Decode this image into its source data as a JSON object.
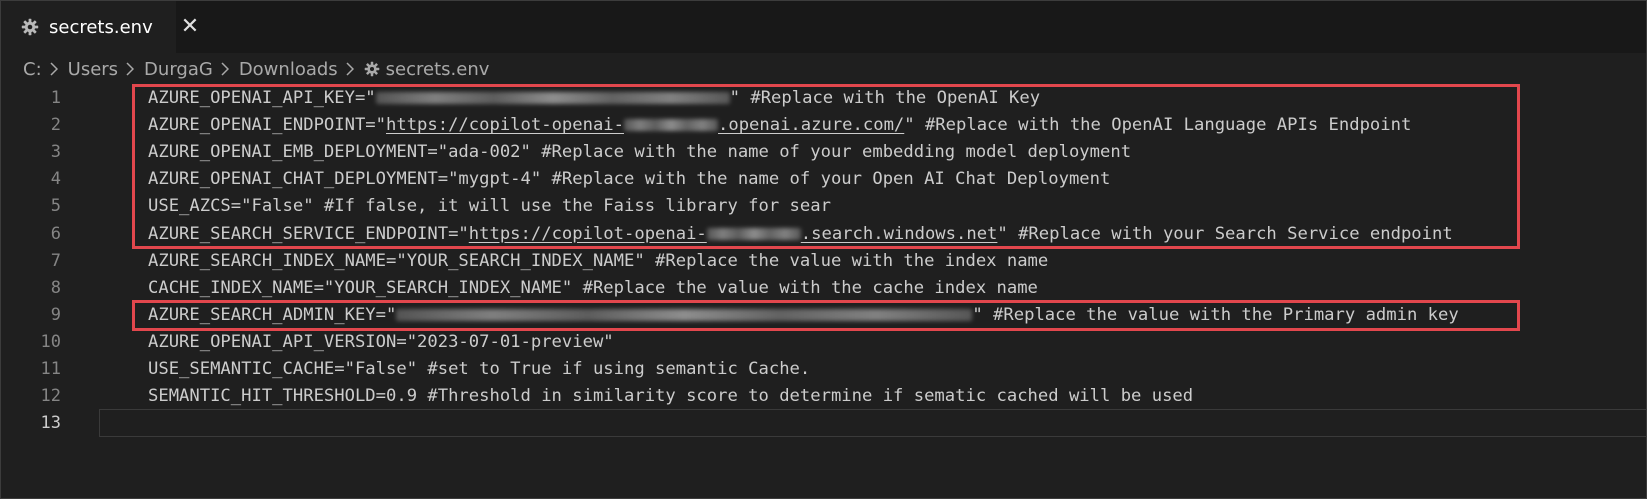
{
  "tab": {
    "title": "secrets.env",
    "close": "✕",
    "icon": "gear-icon"
  },
  "breadcrumb": [
    "C:",
    "Users",
    "DurgaG",
    "Downloads",
    "secrets.env"
  ],
  "lines": [
    {
      "n": "1",
      "segs": [
        {
          "t": "AZURE_OPENAI_API_KEY=\""
        },
        {
          "blur": true
        },
        {
          "t": "\" #Replace with the OpenAI Key"
        }
      ]
    },
    {
      "n": "2",
      "segs": [
        {
          "t": "AZURE_OPENAI_ENDPOINT=\""
        },
        {
          "t": "https://copilot-openai-",
          "ul": true
        },
        {
          "blur": true,
          "ul": true
        },
        {
          "t": ".openai.azure.com/",
          "ul": true
        },
        {
          "t": "\" #Replace with the OpenAI Language APIs Endpoint"
        }
      ]
    },
    {
      "n": "3",
      "segs": [
        {
          "t": "AZURE_OPENAI_EMB_DEPLOYMENT=\"ada-002\" #Replace with the name of your embedding model deployment"
        }
      ]
    },
    {
      "n": "4",
      "segs": [
        {
          "t": "AZURE_OPENAI_CHAT_DEPLOYMENT=\"mygpt-4\" #Replace with the name of your Open AI Chat Deployment"
        }
      ]
    },
    {
      "n": "5",
      "segs": [
        {
          "t": "USE_AZCS=\"False\" #If false, it will use the Faiss library for sear"
        }
      ]
    },
    {
      "n": "6",
      "segs": [
        {
          "t": "AZURE_SEARCH_SERVICE_ENDPOINT=\""
        },
        {
          "t": "https://copilot-openai-",
          "ul": true
        },
        {
          "blur": true,
          "ul": true
        },
        {
          "t": ".search.windows.net",
          "ul": true
        },
        {
          "t": "\" #Replace with your Search Service endpoint"
        }
      ]
    },
    {
      "n": "7",
      "segs": [
        {
          "t": "AZURE_SEARCH_INDEX_NAME=\"YOUR_SEARCH_INDEX_NAME\" #Replace the value with the index name"
        }
      ]
    },
    {
      "n": "8",
      "segs": [
        {
          "t": "CACHE_INDEX_NAME=\"YOUR_SEARCH_INDEX_NAME\" #Replace the value with the cache index name"
        }
      ]
    },
    {
      "n": "9",
      "segs": [
        {
          "t": "AZURE_SEARCH_ADMIN_KEY=\""
        },
        {
          "blur": true
        },
        {
          "t": "\" #Replace the value with the Primary admin key"
        }
      ]
    },
    {
      "n": "10",
      "segs": [
        {
          "t": "AZURE_OPENAI_API_VERSION=\"2023-07-01-preview\""
        }
      ]
    },
    {
      "n": "11",
      "segs": [
        {
          "t": "USE_SEMANTIC_CACHE=\"False\" #set to True if using semantic Cache."
        }
      ]
    },
    {
      "n": "12",
      "segs": [
        {
          "t": "SEMANTIC_HIT_THRESHOLD=0.9 #Threshold in similarity score to determine if sematic cached will be used"
        }
      ]
    },
    {
      "n": "13",
      "segs": []
    }
  ],
  "current_line": "13",
  "highlight_color": "#e2474d"
}
